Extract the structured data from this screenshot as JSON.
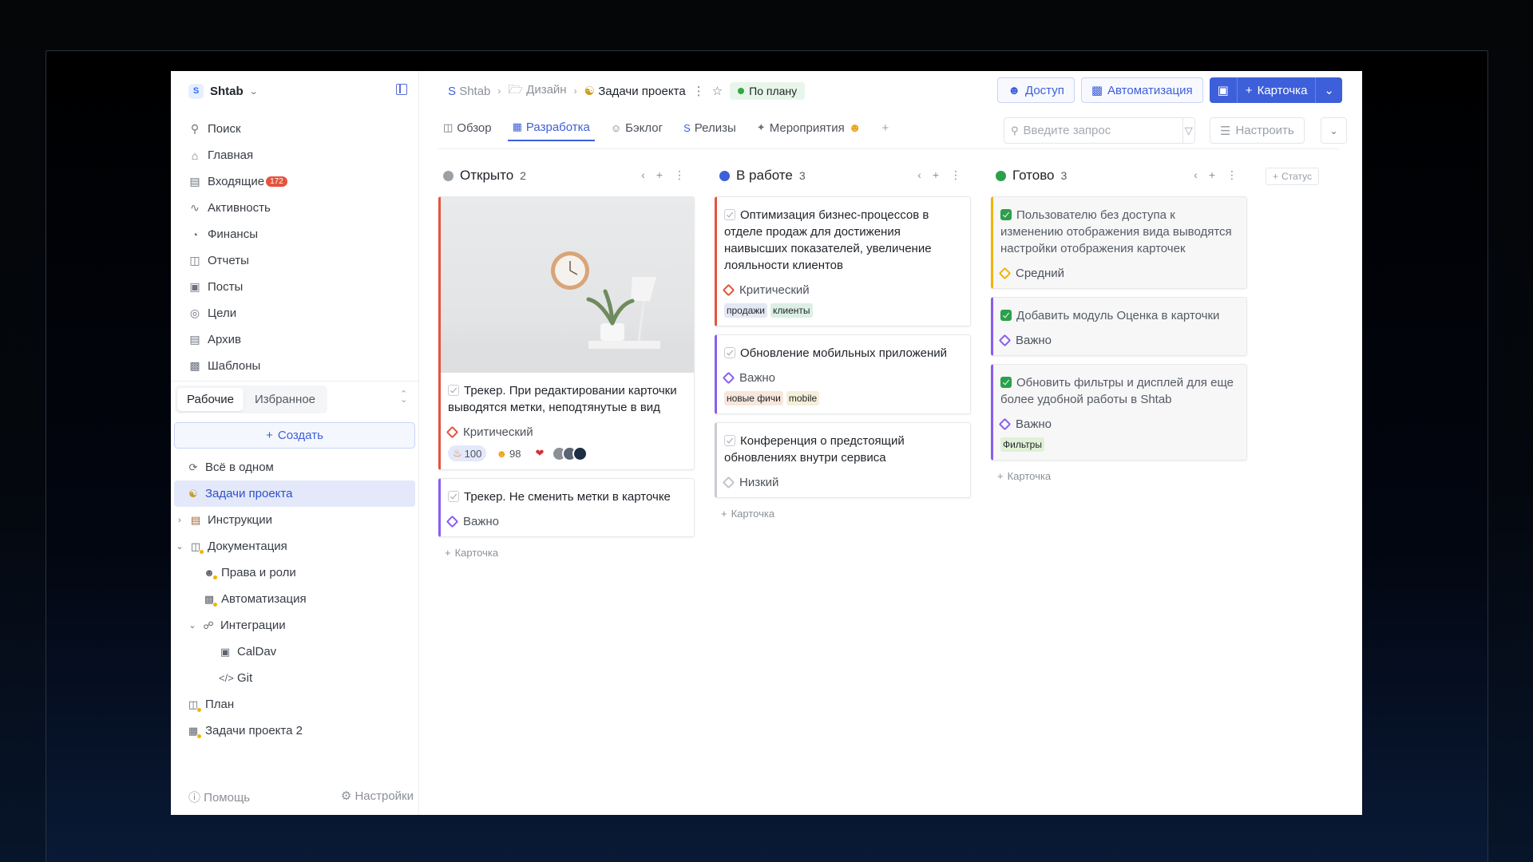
{
  "sidebar": {
    "workspace": "Shtab",
    "logo_letter": "S",
    "nav": [
      {
        "label": "Поиск",
        "icon": "search-icon"
      },
      {
        "label": "Главная",
        "icon": "home-icon"
      },
      {
        "label": "Входящие",
        "icon": "inbox-icon",
        "badge": "172"
      },
      {
        "label": "Активность",
        "icon": "activity-icon"
      },
      {
        "label": "Финансы",
        "icon": "finance-icon"
      },
      {
        "label": "Отчеты",
        "icon": "report-icon"
      },
      {
        "label": "Посты",
        "icon": "rss-icon"
      },
      {
        "label": "Цели",
        "icon": "target-icon"
      },
      {
        "label": "Архив",
        "icon": "archive-icon"
      },
      {
        "label": "Шаблоны",
        "icon": "template-icon"
      }
    ],
    "tabs": [
      "Рабочие",
      "Избранное"
    ],
    "create_label": "Создать",
    "tree": [
      {
        "label": "Всё в одном"
      },
      {
        "label": "Задачи проекта"
      },
      {
        "label": "Инструкции"
      },
      {
        "label": "Документация"
      },
      {
        "label": "Права и роли"
      },
      {
        "label": "Автоматизация"
      },
      {
        "label": "Интеграции"
      },
      {
        "label": "CalDav"
      },
      {
        "label": "Git"
      },
      {
        "label": "План"
      },
      {
        "label": "Задачи проекта 2"
      }
    ],
    "help": "Помощь",
    "settings": "Настройки"
  },
  "header": {
    "crumbs": [
      "Shtab",
      "Дизайн",
      "Задачи проекта"
    ],
    "status": "По плану",
    "access": "Доступ",
    "automation": "Автоматизация",
    "new_card": "Карточка"
  },
  "views": {
    "tabs": [
      "Обзор",
      "Разработка",
      "Бэклог",
      "Релизы",
      "Мероприятия"
    ],
    "search_placeholder": "Введите запрос",
    "configure": "Настроить"
  },
  "board": {
    "add_card": "Карточка",
    "add_status": "Статус",
    "columns": [
      {
        "title": "Открыто",
        "count": "2",
        "color": "#9aa0a6",
        "cards": [
          {
            "title": "Трекер. При редактировании карточки выводятся метки, неподтянутые в вид",
            "priority": "Критический",
            "reacts": [
              "100",
              "98"
            ]
          },
          {
            "title": "Трекер. Не сменить метки в карточке",
            "priority": "Важно"
          }
        ]
      },
      {
        "title": "В работе",
        "count": "3",
        "color": "#3d5fd9",
        "cards": [
          {
            "title": "Оптимизация бизнес-процессов в отделе продаж для достижения наивысших показателей, увеличение лояльности клиентов",
            "priority": "Критический",
            "tags": [
              "продажи",
              "клиенты"
            ]
          },
          {
            "title": "Обновление мобильных приложений",
            "priority": "Важно",
            "tags": [
              "новые фичи",
              "mobile"
            ]
          },
          {
            "title": "Конференция о предстоящий обновлениях внутри сервиса",
            "priority": "Низкий"
          }
        ]
      },
      {
        "title": "Готово",
        "count": "3",
        "color": "#2aa04a",
        "cards": [
          {
            "title": "Пользователю без доступа к изменению отображения вида выводятся настройки отображения карточек",
            "priority": "Средний"
          },
          {
            "title": "Добавить модуль Оценка в карточки",
            "priority": "Важно"
          },
          {
            "title": "Обновить фильтры и дисплей для еще более удобной работы в Shtab",
            "priority": "Важно",
            "tags": [
              "Фильтры"
            ]
          }
        ]
      }
    ]
  }
}
